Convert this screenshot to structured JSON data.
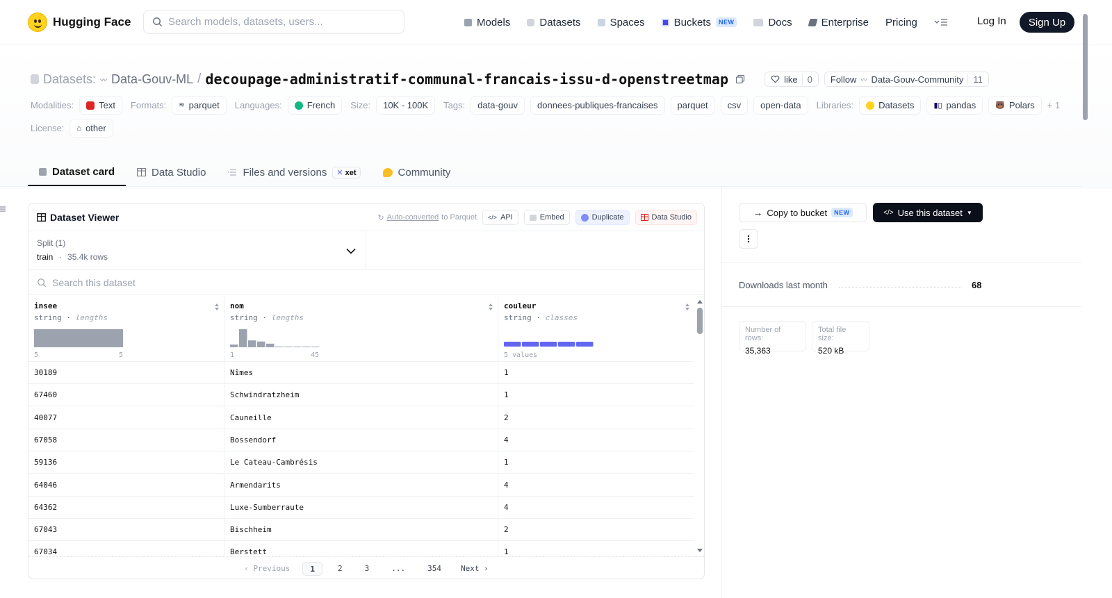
{
  "header": {
    "brand": "Hugging Face",
    "search_placeholder": "Search models, datasets, users...",
    "nav": [
      {
        "label": "Models"
      },
      {
        "label": "Datasets"
      },
      {
        "label": "Spaces"
      },
      {
        "label": "Buckets",
        "badge": "NEW"
      },
      {
        "label": "Docs"
      },
      {
        "label": "Enterprise"
      },
      {
        "label": "Pricing"
      }
    ],
    "login": "Log In",
    "signup": "Sign Up"
  },
  "repo": {
    "kind": "Datasets:",
    "org": "Data-Gouv-ML",
    "separator": "/",
    "name": "decoupage-administratif-communal-francais-issu-d-openstreetmap",
    "like_label": "like",
    "like_count": "0",
    "follow_label": "Follow",
    "follow_org": "Data-Gouv-Community",
    "follow_count": "11"
  },
  "tags": {
    "modalities_label": "Modalities:",
    "modalities": [
      "Text"
    ],
    "formats_label": "Formats:",
    "formats": [
      "parquet"
    ],
    "languages_label": "Languages:",
    "languages": [
      "French"
    ],
    "size_label": "Size:",
    "size": [
      "10K - 100K"
    ],
    "tags_label": "Tags:",
    "tags": [
      "data-gouv",
      "donnees-publiques-francaises",
      "parquet",
      "csv",
      "open-data"
    ],
    "libraries_label": "Libraries:",
    "libraries": [
      "Datasets",
      "pandas",
      "Polars"
    ],
    "libraries_more": "+ 1",
    "license_label": "License:",
    "license": "other"
  },
  "tabs": [
    {
      "label": "Dataset card",
      "active": true
    },
    {
      "label": "Data Studio"
    },
    {
      "label": "Files and versions",
      "badge": "xet"
    },
    {
      "label": "Community"
    }
  ],
  "viewer": {
    "title": "Dataset Viewer",
    "auto_converted_link": "Auto-converted",
    "auto_converted_rest": "to Parquet",
    "buttons": {
      "api": "API",
      "embed": "Embed",
      "duplicate": "Duplicate",
      "data_studio": "Data Studio"
    },
    "split_label": "Split (1)",
    "split_name": "train",
    "split_sep": "·",
    "split_rows": "35.4k rows",
    "search_placeholder": "Search this dataset",
    "columns": [
      {
        "name": "insee",
        "type": "string",
        "stat": "lengths",
        "hist_min": "5",
        "hist_max": "5",
        "hist": [
          1.0
        ]
      },
      {
        "name": "nom",
        "type": "string",
        "stat": "lengths",
        "hist_min": "1",
        "hist_max": "45",
        "hist": [
          0.15,
          1.0,
          0.38,
          0.32,
          0.2,
          0.04,
          0.03,
          0.03,
          0.02,
          0.02
        ]
      },
      {
        "name": "couleur",
        "type": "string",
        "stat": "classes",
        "hist_label": "5 values",
        "classes": 5
      }
    ],
    "rows": [
      [
        "30189",
        "Nîmes",
        "1"
      ],
      [
        "67460",
        "Schwindratzheim",
        "1"
      ],
      [
        "40077",
        "Cauneille",
        "2"
      ],
      [
        "67058",
        "Bossendorf",
        "4"
      ],
      [
        "59136",
        "Le Cateau-Cambrésis",
        "1"
      ],
      [
        "64046",
        "Armendarits",
        "4"
      ],
      [
        "64362",
        "Luxe-Sumberraute",
        "4"
      ],
      [
        "67043",
        "Bischheim",
        "2"
      ],
      [
        "67034",
        "Berstett",
        "1"
      ]
    ],
    "pager": {
      "previous": "Previous",
      "pages": [
        "1",
        "2",
        "3",
        "...",
        "354"
      ],
      "current": "1",
      "next": "Next"
    }
  },
  "sidebar": {
    "copy_to_bucket": "Copy to bucket",
    "copy_badge": "NEW",
    "use_dataset": "Use this dataset",
    "downloads_label": "Downloads last month",
    "downloads_value": "68",
    "rows_label": "Number of rows:",
    "rows_value": "35,363",
    "size_label": "Total file size:",
    "size_value": "520 kB"
  },
  "colors": {
    "accent": "#111827",
    "histogram": "#9ca3af",
    "classes": "#6366f1",
    "text_red": "#dc2626"
  }
}
